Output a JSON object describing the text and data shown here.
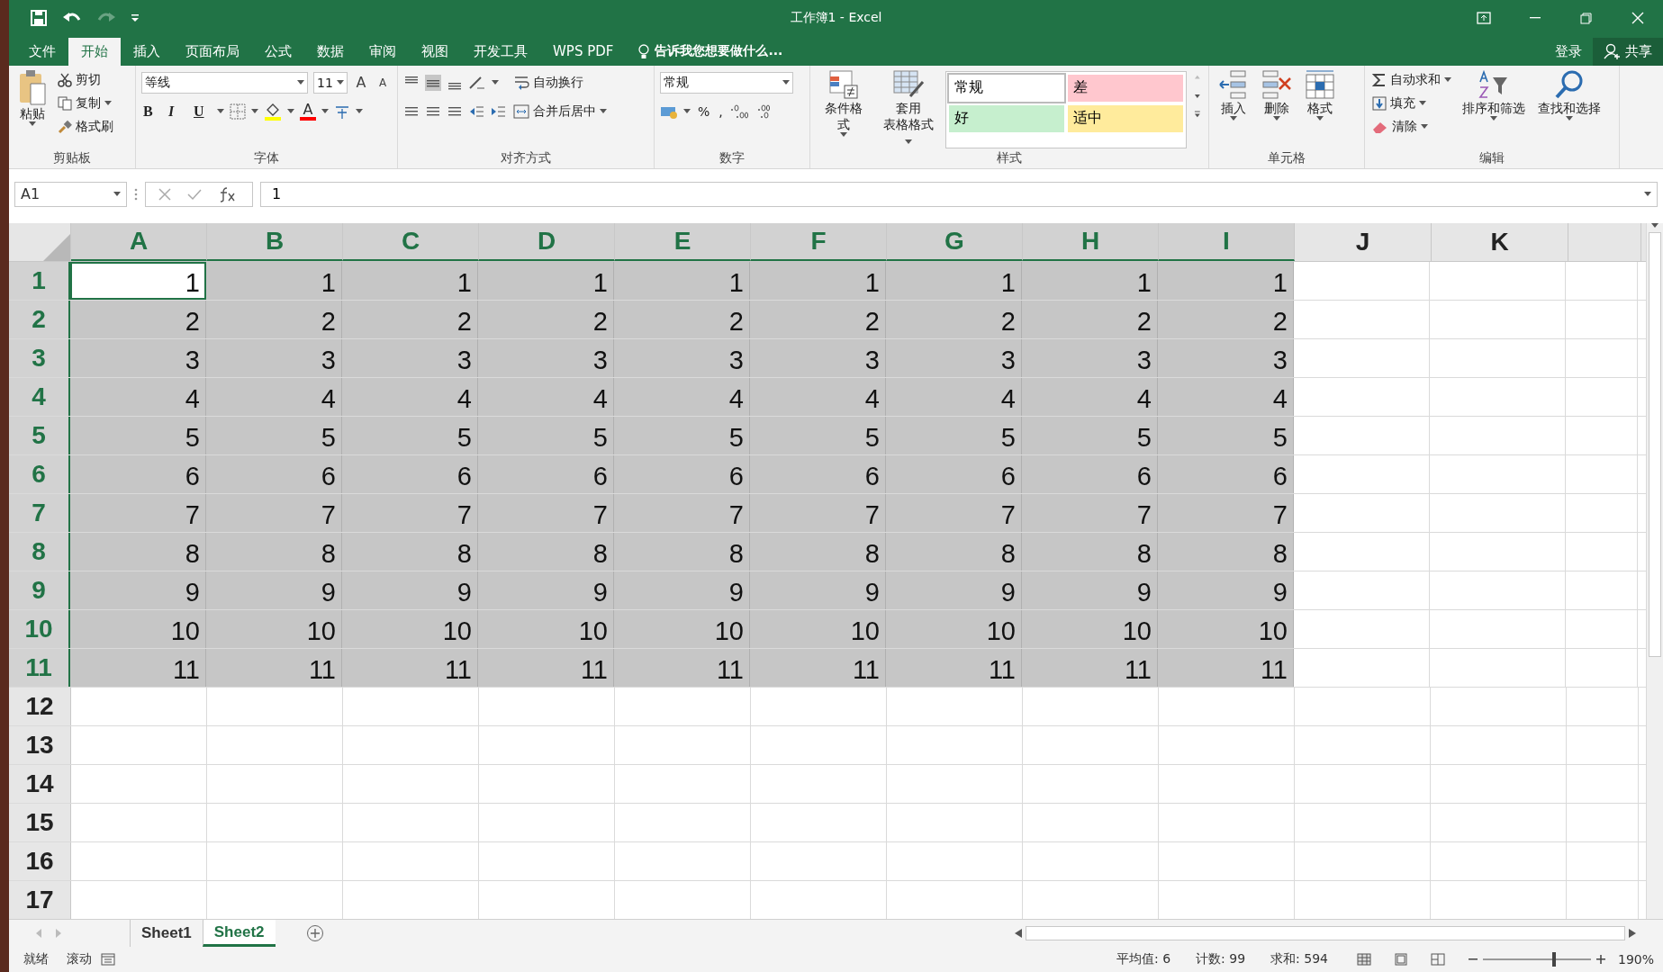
{
  "window": {
    "title": "工作簿1 - Excel"
  },
  "menu_tabs": [
    {
      "label": "文件",
      "selected": false
    },
    {
      "label": "开始",
      "selected": true
    },
    {
      "label": "插入",
      "selected": false
    },
    {
      "label": "页面布局",
      "selected": false
    },
    {
      "label": "公式",
      "selected": false
    },
    {
      "label": "数据",
      "selected": false
    },
    {
      "label": "审阅",
      "selected": false
    },
    {
      "label": "视图",
      "selected": false
    },
    {
      "label": "开发工具",
      "selected": false
    },
    {
      "label": "WPS PDF",
      "selected": false
    }
  ],
  "tell_me": "告诉我您想要做什么...",
  "account": {
    "sign_in": "登录",
    "share": "共享"
  },
  "ribbon": {
    "clipboard": {
      "label": "剪贴板",
      "paste": "粘贴",
      "cut": "剪切",
      "copy": "复制",
      "format_painter": "格式刷"
    },
    "font": {
      "label": "字体",
      "font_name": "等线",
      "font_size": "11",
      "grow_font": "A",
      "shrink_font": "A",
      "font_color": "A",
      "bold": "B",
      "italic": "I",
      "underline": "U"
    },
    "alignment": {
      "label": "对齐方式",
      "wrap_text": "自动换行",
      "merge_center": "合并后居中"
    },
    "number": {
      "label": "数字",
      "format": "常规",
      "percent": "%",
      "comma": ","
    },
    "styles": {
      "label": "样式",
      "conditional": "条件格式",
      "table_line1": "套用",
      "table_line2": "表格格式",
      "cell_styles": [
        {
          "label": "常规",
          "color": "#ffffff"
        },
        {
          "label": "差",
          "color": "#ffc7ce"
        },
        {
          "label": "好",
          "color": "#c6efce"
        },
        {
          "label": "适中",
          "color": "#ffeb9c"
        }
      ]
    },
    "cells": {
      "label": "单元格",
      "insert": "插入",
      "delete": "删除",
      "format": "格式"
    },
    "editing": {
      "label": "编辑",
      "autosum": "自动求和",
      "fill": "填充",
      "clear": "清除",
      "sort_filter": "排序和筛选",
      "find_select": "查找和选择"
    }
  },
  "name_box": "A1",
  "formula": "1",
  "grid": {
    "columns": [
      {
        "label": "A",
        "selected": true
      },
      {
        "label": "B",
        "selected": true
      },
      {
        "label": "C",
        "selected": true
      },
      {
        "label": "D",
        "selected": true
      },
      {
        "label": "E",
        "selected": true
      },
      {
        "label": "F",
        "selected": true
      },
      {
        "label": "G",
        "selected": true
      },
      {
        "label": "H",
        "selected": true
      },
      {
        "label": "I",
        "selected": true
      },
      {
        "label": "J",
        "selected": false
      },
      {
        "label": "K",
        "selected": false
      }
    ],
    "rows": [
      {
        "label": "1",
        "selected": true,
        "cells": [
          "1",
          "1",
          "1",
          "1",
          "1",
          "1",
          "1",
          "1",
          "1"
        ]
      },
      {
        "label": "2",
        "selected": true,
        "cells": [
          "2",
          "2",
          "2",
          "2",
          "2",
          "2",
          "2",
          "2",
          "2"
        ]
      },
      {
        "label": "3",
        "selected": true,
        "cells": [
          "3",
          "3",
          "3",
          "3",
          "3",
          "3",
          "3",
          "3",
          "3"
        ]
      },
      {
        "label": "4",
        "selected": true,
        "cells": [
          "4",
          "4",
          "4",
          "4",
          "4",
          "4",
          "4",
          "4",
          "4"
        ]
      },
      {
        "label": "5",
        "selected": true,
        "cells": [
          "5",
          "5",
          "5",
          "5",
          "5",
          "5",
          "5",
          "5",
          "5"
        ]
      },
      {
        "label": "6",
        "selected": true,
        "cells": [
          "6",
          "6",
          "6",
          "6",
          "6",
          "6",
          "6",
          "6",
          "6"
        ]
      },
      {
        "label": "7",
        "selected": true,
        "cells": [
          "7",
          "7",
          "7",
          "7",
          "7",
          "7",
          "7",
          "7",
          "7"
        ]
      },
      {
        "label": "8",
        "selected": true,
        "cells": [
          "8",
          "8",
          "8",
          "8",
          "8",
          "8",
          "8",
          "8",
          "8"
        ]
      },
      {
        "label": "9",
        "selected": true,
        "cells": [
          "9",
          "9",
          "9",
          "9",
          "9",
          "9",
          "9",
          "9",
          "9"
        ]
      },
      {
        "label": "10",
        "selected": true,
        "cells": [
          "10",
          "10",
          "10",
          "10",
          "10",
          "10",
          "10",
          "10",
          "10"
        ]
      },
      {
        "label": "11",
        "selected": true,
        "cells": [
          "11",
          "11",
          "11",
          "11",
          "11",
          "11",
          "11",
          "11",
          "11"
        ]
      },
      {
        "label": "12",
        "selected": false
      },
      {
        "label": "13",
        "selected": false
      },
      {
        "label": "14",
        "selected": false
      },
      {
        "label": "15",
        "selected": false
      },
      {
        "label": "16",
        "selected": false
      },
      {
        "label": "17",
        "selected": false
      }
    ]
  },
  "sheet_tabs": [
    {
      "label": "Sheet1",
      "selected": false
    },
    {
      "label": "Sheet2",
      "selected": true
    }
  ],
  "status_bar": {
    "mode": "就绪",
    "scroll": "滚动",
    "average": "平均值: 6",
    "count": "计数: 99",
    "sum": "求和: 594",
    "zoom": "190%",
    "zoom_slider": {
      "level": 0.64
    }
  }
}
